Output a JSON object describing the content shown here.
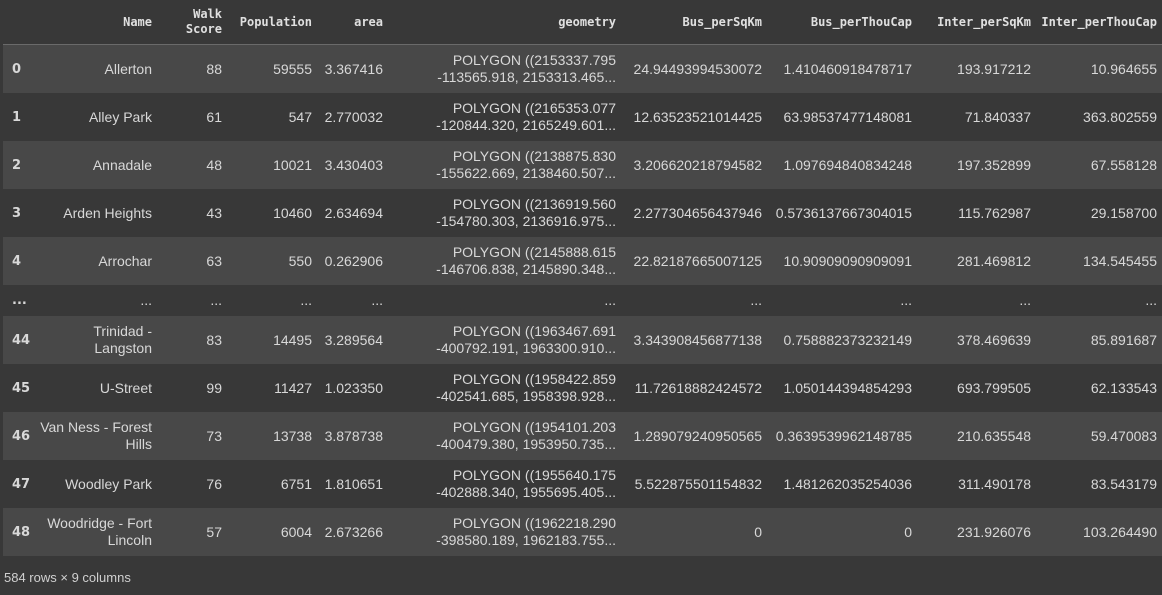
{
  "table": {
    "columns": [
      "",
      "Name",
      "Walk\nScore",
      "Population",
      "area",
      "geometry",
      "Bus_perSqKm",
      "Bus_perThouCap",
      "Inter_perSqKm",
      "Inter_perThouCap"
    ],
    "rows": [
      {
        "idx": "0",
        "Name": "Allerton",
        "Walk_Score": "88",
        "Population": "59555",
        "area": "3.367416",
        "geometry": "POLYGON ((2153337.795 -113565.918, 2153313.465...",
        "Bus_perSqKm": "24.94493994530072",
        "Bus_perThouCap": "1.410460918478717",
        "Inter_perSqKm": "193.917212",
        "Inter_perThouCap": "10.964655"
      },
      {
        "idx": "1",
        "Name": "Alley Park",
        "Walk_Score": "61",
        "Population": "547",
        "area": "2.770032",
        "geometry": "POLYGON ((2165353.077 -120844.320, 2165249.601...",
        "Bus_perSqKm": "12.63523521014425",
        "Bus_perThouCap": "63.98537477148081",
        "Inter_perSqKm": "71.840337",
        "Inter_perThouCap": "363.802559"
      },
      {
        "idx": "2",
        "Name": "Annadale",
        "Walk_Score": "48",
        "Population": "10021",
        "area": "3.430403",
        "geometry": "POLYGON ((2138875.830 -155622.669, 2138460.507...",
        "Bus_perSqKm": "3.206620218794582",
        "Bus_perThouCap": "1.097694840834248",
        "Inter_perSqKm": "197.352899",
        "Inter_perThouCap": "67.558128"
      },
      {
        "idx": "3",
        "Name": "Arden Heights",
        "Walk_Score": "43",
        "Population": "10460",
        "area": "2.634694",
        "geometry": "POLYGON ((2136919.560 -154780.303, 2136916.975...",
        "Bus_perSqKm": "2.277304656437946",
        "Bus_perThouCap": "0.5736137667304015",
        "Inter_perSqKm": "115.762987",
        "Inter_perThouCap": "29.158700"
      },
      {
        "idx": "4",
        "Name": "Arrochar",
        "Walk_Score": "63",
        "Population": "550",
        "area": "0.262906",
        "geometry": "POLYGON ((2145888.615 -146706.838, 2145890.348...",
        "Bus_perSqKm": "22.82187665007125",
        "Bus_perThouCap": "10.90909090909091",
        "Inter_perSqKm": "281.469812",
        "Inter_perThouCap": "134.545455"
      },
      {
        "idx": "...",
        "Name": "...",
        "Walk_Score": "...",
        "Population": "...",
        "area": "...",
        "geometry": "...",
        "Bus_perSqKm": "...",
        "Bus_perThouCap": "...",
        "Inter_perSqKm": "...",
        "Inter_perThouCap": "..."
      },
      {
        "idx": "44",
        "Name": "Trinidad - Langston",
        "Walk_Score": "83",
        "Population": "14495",
        "area": "3.289564",
        "geometry": "POLYGON ((1963467.691 -400792.191, 1963300.910...",
        "Bus_perSqKm": "3.343908456877138",
        "Bus_perThouCap": "0.758882373232149",
        "Inter_perSqKm": "378.469639",
        "Inter_perThouCap": "85.891687"
      },
      {
        "idx": "45",
        "Name": "U-Street",
        "Walk_Score": "99",
        "Population": "11427",
        "area": "1.023350",
        "geometry": "POLYGON ((1958422.859 -402541.685, 1958398.928...",
        "Bus_perSqKm": "11.72618882424572",
        "Bus_perThouCap": "1.050144394854293",
        "Inter_perSqKm": "693.799505",
        "Inter_perThouCap": "62.133543"
      },
      {
        "idx": "46",
        "Name": "Van Ness - Forest Hills",
        "Walk_Score": "73",
        "Population": "13738",
        "area": "3.878738",
        "geometry": "POLYGON ((1954101.203 -400479.380, 1953950.735...",
        "Bus_perSqKm": "1.289079240950565",
        "Bus_perThouCap": "0.3639539962148785",
        "Inter_perSqKm": "210.635548",
        "Inter_perThouCap": "59.470083"
      },
      {
        "idx": "47",
        "Name": "Woodley Park",
        "Walk_Score": "76",
        "Population": "6751",
        "area": "1.810651",
        "geometry": "POLYGON ((1955640.175 -402888.340, 1955695.405...",
        "Bus_perSqKm": "5.522875501154832",
        "Bus_perThouCap": "1.481262035254036",
        "Inter_perSqKm": "311.490178",
        "Inter_perThouCap": "83.543179"
      },
      {
        "idx": "48",
        "Name": "Woodridge - Fort Lincoln",
        "Walk_Score": "57",
        "Population": "6004",
        "area": "2.673266",
        "geometry": "POLYGON ((1962218.290 -398580.189, 1962183.755...",
        "Bus_perSqKm": "0",
        "Bus_perThouCap": "0",
        "Inter_perSqKm": "231.926076",
        "Inter_perThouCap": "103.264490"
      }
    ]
  },
  "footer": {
    "summary": "584 rows × 9 columns"
  }
}
